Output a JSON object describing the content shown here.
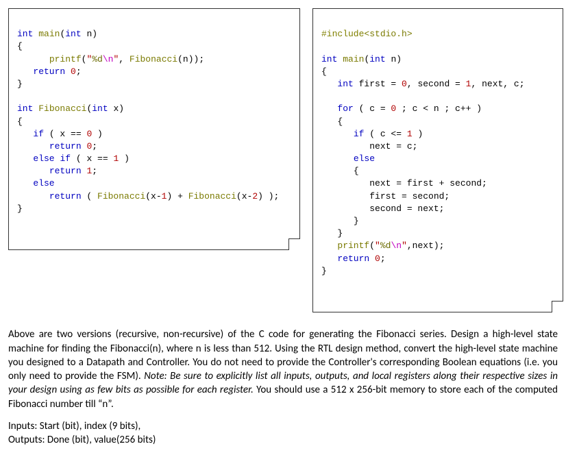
{
  "code_left": {
    "l1": {
      "pre": "",
      "kw1": "int",
      "mid1": " ",
      "fn": "main",
      "mid2": "(",
      "kw2": "int",
      "mid3": " n)"
    },
    "l2": "{",
    "l3": {
      "pre": "      ",
      "fn": "printf",
      "open": "(",
      "q1": "\"",
      "fmt": "%d",
      "esc": "\\n",
      "q2": "\"",
      "mid": ", ",
      "call": "Fibonacci",
      "args": "(n));"
    },
    "l4": {
      "pre": "   ",
      "kw": "return",
      "sp": " ",
      "num": "0",
      "end": ";"
    },
    "l5": "}",
    "l6": " ",
    "l7": {
      "pre": "",
      "kw1": "int",
      "sp": " ",
      "fn": "Fibonacci",
      "open": "(",
      "kw2": "int",
      "args": " x)"
    },
    "l8": "{",
    "l9": {
      "pre": "   ",
      "kw": "if",
      "mid1": " ( x == ",
      "num": "0",
      "mid2": " )"
    },
    "l10": {
      "pre": "      ",
      "kw": "return",
      "sp": " ",
      "num": "0",
      "end": ";"
    },
    "l11": {
      "pre": "   ",
      "kw1": "else",
      "sp1": " ",
      "kw2": "if",
      "mid1": " ( x == ",
      "num": "1",
      "mid2": " )"
    },
    "l12": {
      "pre": "      ",
      "kw": "return",
      "sp": " ",
      "num": "1",
      "end": ";"
    },
    "l13": {
      "pre": "   ",
      "kw": "else"
    },
    "l14": {
      "pre": "      ",
      "kw": "return",
      "mid1": " ( ",
      "f1": "Fibonacci",
      "a1": "(x-",
      "n1": "1",
      "m1": ") + ",
      "f2": "Fibonacci",
      "a2": "(x-",
      "n2": "2",
      "m2": ") );"
    },
    "l15": "}"
  },
  "code_right": {
    "l1": {
      "pp": "#include",
      "rest": "<stdio.h>"
    },
    "l2": " ",
    "l3": {
      "kw1": "int",
      "sp": " ",
      "fn": "main",
      "open": "(",
      "kw2": "int",
      "args": " n)"
    },
    "l4": "{",
    "l5": {
      "pre": "   ",
      "kw": "int",
      "mid1": " first = ",
      "n0": "0",
      "mid2": ", second = ",
      "n1": "1",
      "mid3": ", next, c;"
    },
    "l6": " ",
    "l7": {
      "pre": "   ",
      "kw": "for",
      "mid1": " ( c = ",
      "n0": "0",
      "mid2": " ; c < n ; c++ )"
    },
    "l8": {
      "pre": "   ",
      "txt": "{"
    },
    "l9": {
      "pre": "      ",
      "kw": "if",
      "mid1": " ( c <= ",
      "n1": "1",
      "mid2": " )"
    },
    "l10": {
      "pre": "         ",
      "txt": "next = c;"
    },
    "l11": {
      "pre": "      ",
      "kw": "else"
    },
    "l12": {
      "pre": "      ",
      "txt": "{"
    },
    "l13": {
      "pre": "         ",
      "txt": "next = first + second;"
    },
    "l14": {
      "pre": "         ",
      "txt": "first = second;"
    },
    "l15": {
      "pre": "         ",
      "txt": "second = next;"
    },
    "l16": {
      "pre": "      ",
      "txt": "}"
    },
    "l17": {
      "pre": "   ",
      "txt": "}"
    },
    "l18": {
      "pre": "   ",
      "fn": "printf",
      "open": "(",
      "q1": "\"",
      "fmt": "%d",
      "esc": "\\n",
      "q2": "\"",
      "mid": ",next);"
    },
    "l19": {
      "pre": "   ",
      "kw": "return",
      "sp": " ",
      "num": "0",
      "end": ";"
    },
    "l20": "}"
  },
  "prompt": {
    "p1a": "Above are two versions (recursive, non-recursive) of the C code for generating the Fibonacci series. Design a high-level state machine for finding the Fibonacci(n), where n is less than 512.  Using the RTL design method, convert the high-level state machine you designed to a Datapath and Controller. You do not need to provide the Controller's corresponding Boolean equations (i.e. you only need to provide the FSM). ",
    "note": "Note: Be sure to explicitly list all inputs, outputs, and local registers along their respective sizes in your design using as few bits as possible for each register.",
    "p1b": " You should use a 512 x 256-bit memory to store each of the computed Fibonacci number till “n”.",
    "inputs": "Inputs: Start (bit), index (9 bits),",
    "outputs": "Outputs: Done (bit), value(256 bits)"
  }
}
